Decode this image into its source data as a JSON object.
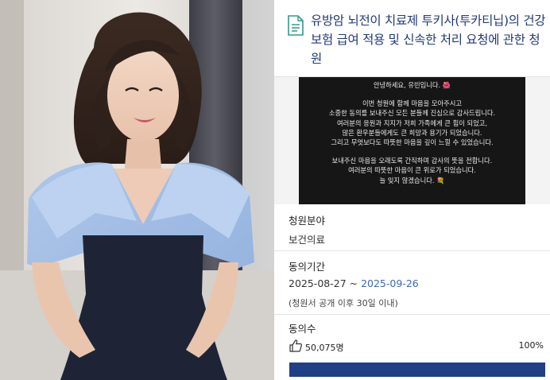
{
  "petition": {
    "title": "유방암 뇌전이 치료제 투키사(투카티닙)의 건강보험 급여 적용 및 신속한 처리 요청에 관한 청원"
  },
  "message": {
    "greeting": "안녕하세요, 유빈입니다.",
    "lines": [
      "이번 청원에 함께 마음을 모아주시고",
      "소중한 동의를 보내주신 모든 분들께 진심으로 감사드립니다.",
      "여러분의 응원과 지지가 저희 가족에게 큰 힘이 되었고,",
      "많은 환우분들에게도 큰 희망과 용기가 되었습니다.",
      "그리고 무엇보다도 따뜻한 마음을 깊이 느낄 수 있었습니다.",
      "보내주신 마음을 오래도록 간직하며 감사의 뜻을 전합니다.",
      "여러분의 따뜻한 마음이 큰 위로가 되었습니다.",
      "늘 잊지 않겠습니다."
    ]
  },
  "category": {
    "label": "청원분야",
    "value": "보건의료"
  },
  "period": {
    "label": "동의기간",
    "start": "2025-08-27",
    "separator": " ~ ",
    "end": "2025-09-26",
    "note": "(청원서 공개 이후 30일 이내)"
  },
  "consent": {
    "label": "동의수",
    "count": "50,075명",
    "percent": "100%",
    "progress": 1.0
  },
  "icons": {
    "title": "document-icon",
    "count": "thumbs-up-icon",
    "greeting": "flower-emoji",
    "closing": "bouquet-emoji"
  },
  "colors": {
    "title": "#1f3a77",
    "period_end": "#3a67c4",
    "progress_fill": "#1f3f87",
    "progress_track": "#dde2ee",
    "message_bg": "#161616"
  }
}
